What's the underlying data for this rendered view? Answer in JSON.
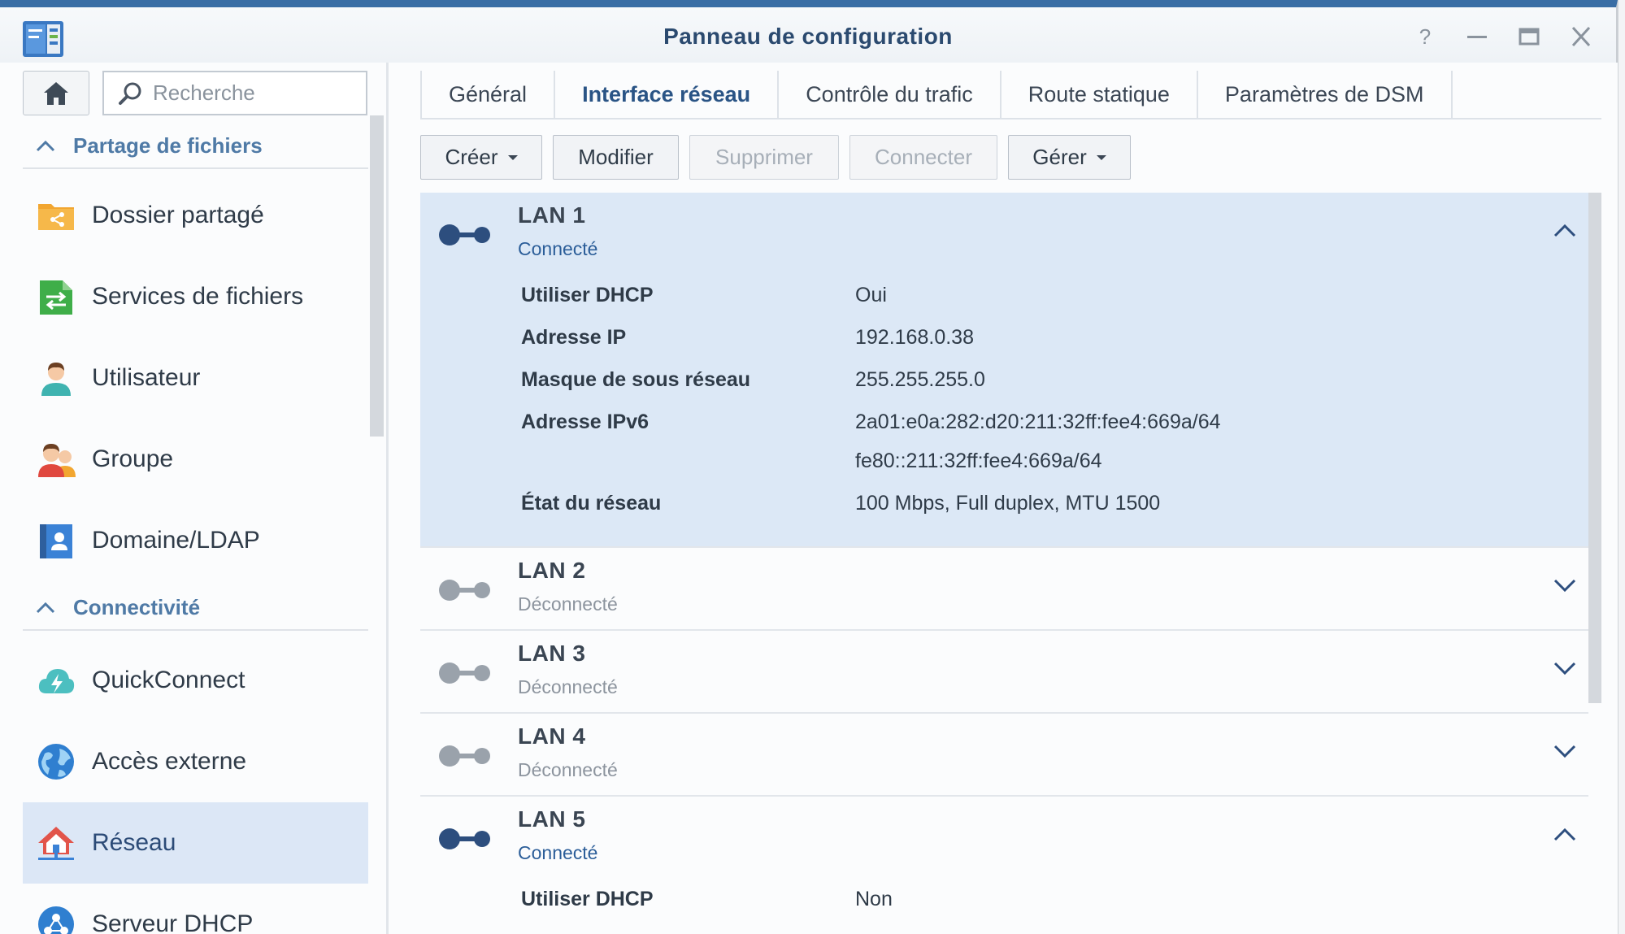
{
  "window": {
    "title": "Panneau de configuration"
  },
  "sidebar": {
    "search_placeholder": "Recherche",
    "sections": [
      {
        "title": "Partage de fichiers",
        "items": [
          {
            "label": "Dossier partagé",
            "icon": "shared-folder-icon"
          },
          {
            "label": "Services de fichiers",
            "icon": "file-services-icon"
          },
          {
            "label": "Utilisateur",
            "icon": "user-icon"
          },
          {
            "label": "Groupe",
            "icon": "group-icon"
          },
          {
            "label": "Domaine/LDAP",
            "icon": "domain-ldap-icon"
          }
        ]
      },
      {
        "title": "Connectivité",
        "items": [
          {
            "label": "QuickConnect",
            "icon": "quickconnect-icon"
          },
          {
            "label": "Accès externe",
            "icon": "external-access-icon"
          },
          {
            "label": "Réseau",
            "icon": "network-icon",
            "active": true
          },
          {
            "label": "Serveur DHCP",
            "icon": "dhcp-server-icon"
          }
        ]
      }
    ]
  },
  "tabs": [
    {
      "label": "Général"
    },
    {
      "label": "Interface réseau",
      "active": true
    },
    {
      "label": "Contrôle du trafic"
    },
    {
      "label": "Route statique"
    },
    {
      "label": "Paramètres de DSM"
    }
  ],
  "toolbar": {
    "create": "Créer",
    "modify": "Modifier",
    "delete": "Supprimer",
    "connect": "Connecter",
    "manage": "Gérer"
  },
  "interfaces": [
    {
      "name": "LAN 1",
      "status": "Connecté",
      "details": [
        {
          "label": "Utiliser DHCP",
          "value": "Oui"
        },
        {
          "label": "Adresse IP",
          "value": "192.168.0.38"
        },
        {
          "label": "Masque de sous réseau",
          "value": "255.255.255.0"
        },
        {
          "label": "Adresse IPv6",
          "value": "2a01:e0a:282:d20:211:32ff:fee4:669a/64"
        },
        {
          "label": "",
          "value": "fe80::211:32ff:fee4:669a/64"
        },
        {
          "label": "État du réseau",
          "value": "100 Mbps, Full duplex, MTU 1500"
        }
      ]
    },
    {
      "name": "LAN 2",
      "status": "Déconnecté"
    },
    {
      "name": "LAN 3",
      "status": "Déconnecté"
    },
    {
      "name": "LAN 4",
      "status": "Déconnecté"
    },
    {
      "name": "LAN 5",
      "status": "Connecté",
      "details": [
        {
          "label": "Utiliser DHCP",
          "value": "Non"
        }
      ]
    }
  ],
  "colors": {
    "accent": "#2c5e99",
    "selected_bg": "#dce8f6",
    "connected_icon": "#2d4e7e",
    "disconnected_icon": "#9aa2ab"
  }
}
